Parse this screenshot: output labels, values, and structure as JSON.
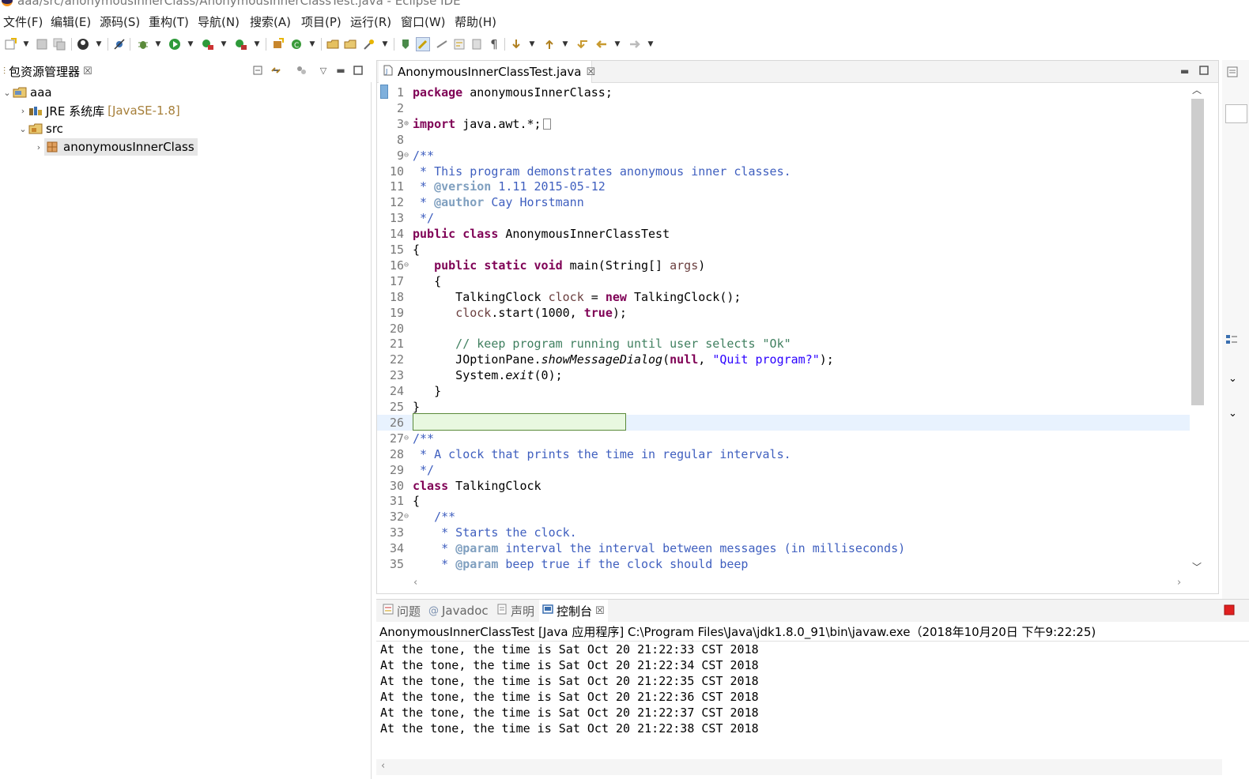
{
  "window": {
    "title": "aaa/src/anonymousInnerClass/AnonymousInnerClassTest.java - Eclipse IDE"
  },
  "menu": [
    "文件(F)",
    "编辑(E)",
    "源码(S)",
    "重构(T)",
    "导航(N)",
    "搜索(A)",
    "项目(P)",
    "运行(R)",
    "窗口(W)",
    "帮助(H)"
  ],
  "package_explorer": {
    "title": "包资源管理器",
    "close": "☒",
    "project": "aaa",
    "jre": "JRE 系统库",
    "jre_version": "[JavaSE-1.8]",
    "src": "src",
    "package": "anonymousInnerClass"
  },
  "editor": {
    "tab_title": "AnonymousInnerClassTest.java",
    "close": "☒",
    "lines": [
      {
        "n": "1",
        "t": "package anonymousInnerClass;"
      },
      {
        "n": "2",
        "t": ""
      },
      {
        "n": "3",
        "t": "import java.awt.*;"
      },
      {
        "n": "8",
        "t": ""
      },
      {
        "n": "9",
        "t": "/**"
      },
      {
        "n": "10",
        "t": " * This program demonstrates anonymous inner classes."
      },
      {
        "n": "11",
        "t": " * @version 1.11 2015-05-12"
      },
      {
        "n": "12",
        "t": " * @author Cay Horstmann"
      },
      {
        "n": "13",
        "t": " */"
      },
      {
        "n": "14",
        "t": "public class AnonymousInnerClassTest"
      },
      {
        "n": "15",
        "t": "{"
      },
      {
        "n": "16",
        "t": "   public static void main(String[] args)"
      },
      {
        "n": "17",
        "t": "   {"
      },
      {
        "n": "18",
        "t": "      TalkingClock clock = new TalkingClock();"
      },
      {
        "n": "19",
        "t": "      clock.start(1000, true);"
      },
      {
        "n": "20",
        "t": ""
      },
      {
        "n": "21",
        "t": "      // keep program running until user selects \"Ok\""
      },
      {
        "n": "22",
        "t": "      JOptionPane.showMessageDialog(null, \"Quit program?\");"
      },
      {
        "n": "23",
        "t": "      System.exit(0);"
      },
      {
        "n": "24",
        "t": "   }"
      },
      {
        "n": "25",
        "t": "}"
      },
      {
        "n": "26",
        "t": ""
      },
      {
        "n": "27",
        "t": "/**"
      },
      {
        "n": "28",
        "t": " * A clock that prints the time in regular intervals."
      },
      {
        "n": "29",
        "t": " */"
      },
      {
        "n": "30",
        "t": "class TalkingClock"
      },
      {
        "n": "31",
        "t": "{"
      },
      {
        "n": "32",
        "t": "   /**"
      },
      {
        "n": "33",
        "t": "    * Starts the clock."
      },
      {
        "n": "34",
        "t": "    * @param interval the interval between messages (in milliseconds)"
      },
      {
        "n": "35",
        "t": "    * @param beep true if the clock should beep"
      }
    ]
  },
  "console": {
    "tabs": [
      {
        "label": "问题",
        "icon": "problems-icon"
      },
      {
        "label": "Javadoc",
        "icon": "javadoc-icon"
      },
      {
        "label": "声明",
        "icon": "declaration-icon"
      },
      {
        "label": "控制台",
        "icon": "console-icon"
      }
    ],
    "close": "☒",
    "description": "AnonymousInnerClassTest [Java 应用程序] C:\\Program Files\\Java\\jdk1.8.0_91\\bin\\javaw.exe（2018年10月20日 下午9:22:25)",
    "output": [
      "At the tone, the time is Sat Oct 20 21:22:33 CST 2018",
      "At the tone, the time is Sat Oct 20 21:22:34 CST 2018",
      "At the tone, the time is Sat Oct 20 21:22:35 CST 2018",
      "At the tone, the time is Sat Oct 20 21:22:36 CST 2018",
      "At the tone, the time is Sat Oct 20 21:22:37 CST 2018",
      "At the tone, the time is Sat Oct 20 21:22:38 CST 2018"
    ]
  },
  "colors": {
    "keyword": "#7f0055",
    "comment": "#3f7f5f",
    "javadoc": "#3f5fbf",
    "string": "#2a00ff",
    "terminate": "#e02020"
  }
}
